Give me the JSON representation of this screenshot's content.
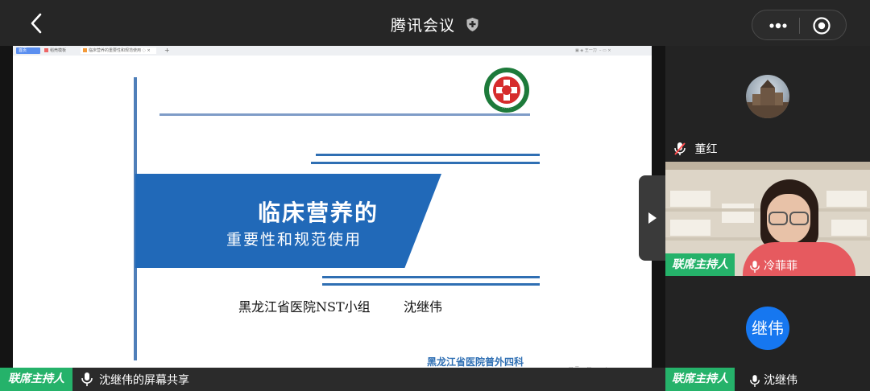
{
  "header": {
    "title": "腾讯会议",
    "back_icon": "chevron-left-icon",
    "security_icon": "shield-plus-icon",
    "more_icon": "more-dots-icon",
    "record_icon": "target-circle-icon"
  },
  "browser": {
    "tabs": [
      {
        "label": "首页"
      },
      {
        "label": "稻壳模板"
      },
      {
        "label": "临床营养的重要性和规范使用"
      }
    ],
    "right_text": "王一刀"
  },
  "slide": {
    "title_line1": "临床营养的",
    "title_line2": "重要性和规范使用",
    "authors": "黑龙江省医院NST小组",
    "author_name": "沈继伟",
    "department": "黑龙江省医院普外四科",
    "bottom_tools": "□ ☰ ▭ ▣ —— +"
  },
  "status": {
    "host_badge": "联席主持人",
    "text": "沈继伟的屏幕共享"
  },
  "participants": [
    {
      "name": "董红",
      "muted": true
    },
    {
      "name": "冷菲菲",
      "badge": "联席主持人",
      "video": true
    },
    {
      "name": "沈继伟",
      "badge": "联席主持人",
      "avatar_text": "继伟"
    }
  ],
  "colors": {
    "host_green": "#25b26a",
    "slide_blue": "#2169b8",
    "avatar_blue": "#1677f0"
  }
}
